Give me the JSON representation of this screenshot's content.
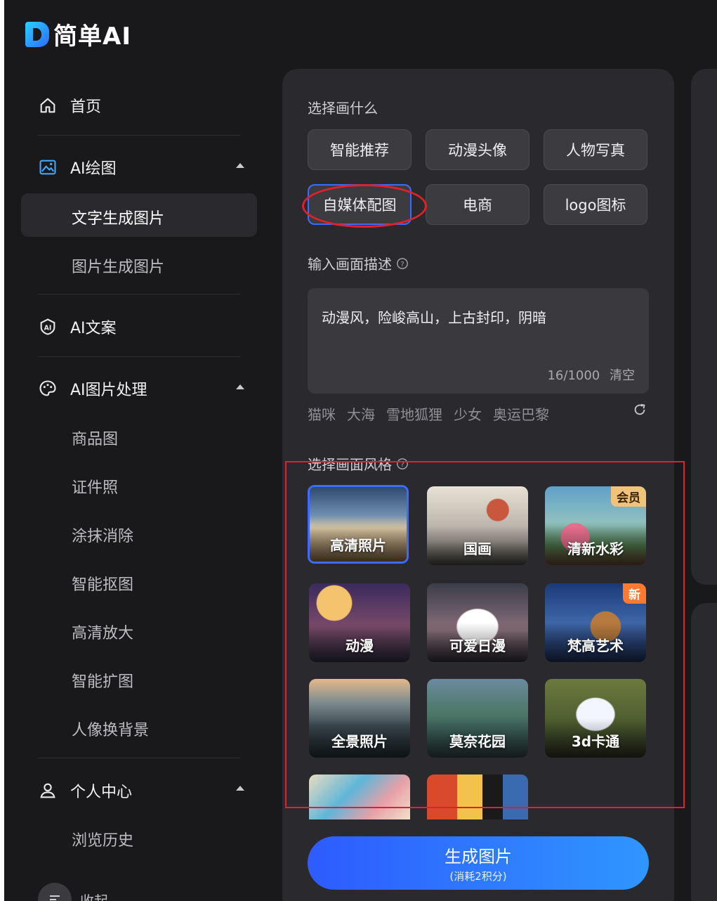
{
  "brand": {
    "name": "简单AI"
  },
  "sidebar": {
    "home": "首页",
    "ai_drawing": "AI绘图",
    "drawing_items": [
      "文字生成图片",
      "图片生成图片"
    ],
    "ai_copy": "AI文案",
    "ai_image": "AI图片处理",
    "image_items": [
      "商品图",
      "证件照",
      "涂抹消除",
      "智能抠图",
      "高清放大",
      "智能扩图",
      "人像换背景"
    ],
    "personal": "个人中心",
    "personal_items": [
      "浏览历史"
    ],
    "collapse": "收起"
  },
  "panel": {
    "what_title": "选择画什么",
    "types": [
      "智能推荐",
      "动漫头像",
      "人物写真",
      "自媒体配图",
      "电商",
      "logo图标"
    ],
    "desc_title": "输入画面描述",
    "prompt": "动漫风，险峻高山，上古封印，阴暗",
    "count": "16/1000",
    "clear": "清空",
    "suggestions": [
      "猫咪",
      "大海",
      "雪地狐狸",
      "少女",
      "奥运巴黎"
    ],
    "style_title": "选择画面风格",
    "styles": [
      "高清照片",
      "国画",
      "清新水彩",
      "动漫",
      "可爱日漫",
      "梵高艺术",
      "全景照片",
      "莫奈花园",
      "3d卡通"
    ],
    "badge_vip": "会员",
    "badge_new": "新",
    "generate": "生成图片",
    "generate_cost": "(消耗2积分)"
  },
  "colors": {
    "accent": "#3d6bff",
    "annotation_red": "#e3202a",
    "background": "#19191c",
    "panel": "#2a2a2e"
  }
}
